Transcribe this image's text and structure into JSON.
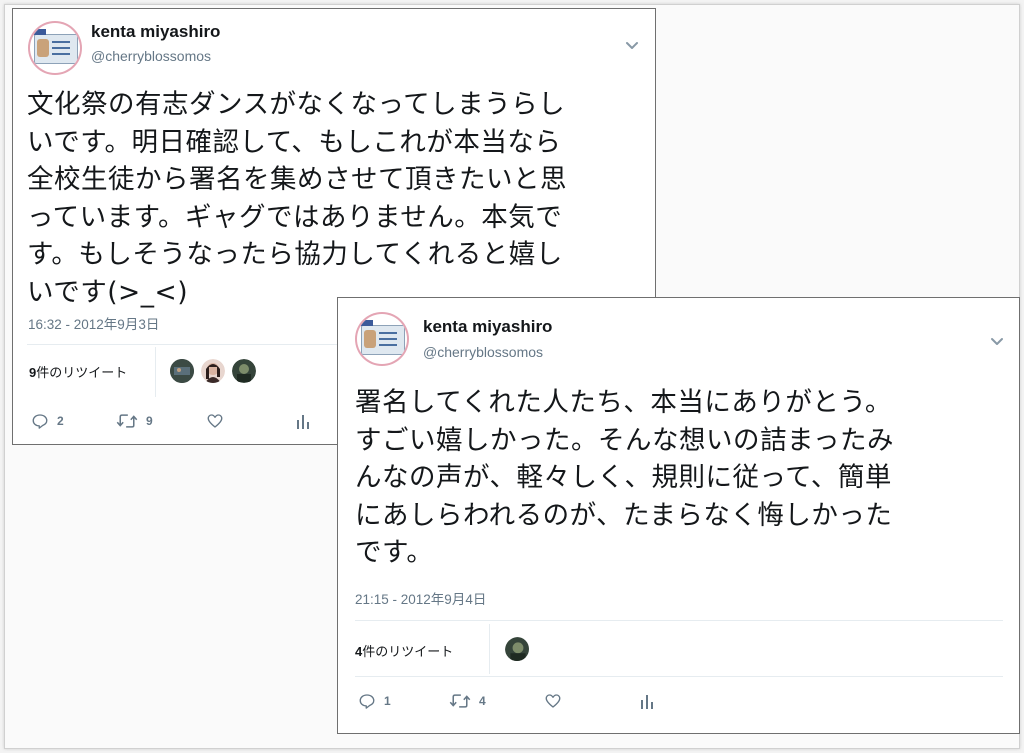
{
  "tweets": [
    {
      "author_name": "kenta miyashiro",
      "handle": "@cherryblossomos",
      "lines": [
        "文化祭の有志ダンスがなくなってしまうらし",
        "いです。明日確認して、もしこれが本当なら",
        "全校生徒から署名を集めさせて頂きたいと思",
        "っています。ギャグではありません。本気で",
        "す。もしそうなったら協力してくれると嬉し",
        "いです(>_<)"
      ],
      "timestamp": "16:32 - 2012年9月3日",
      "retweets_count": "9",
      "retweets_label": "件のリツイート",
      "replies": "2",
      "retweets": "9"
    },
    {
      "author_name": "kenta miyashiro",
      "handle": "@cherryblossomos",
      "lines": [
        "署名してくれた人たち、本当にありがとう。",
        "すごい嬉しかった。そんな想いの詰まったみ",
        "んなの声が、軽々しく、規則に従って、簡単",
        "にあしらわれるのが、たまらなく悔しかった",
        "です。"
      ],
      "timestamp": "21:15 - 2012年9月4日",
      "retweets_count": "4",
      "retweets_label": "件のリツイート",
      "replies": "1",
      "retweets": "4"
    }
  ],
  "icons": {
    "reply": "reply-icon",
    "retweet": "retweet-icon",
    "like": "heart-icon",
    "analytics": "analytics-icon",
    "more": "chevron-down-icon"
  },
  "colors": {
    "text": "#14171a",
    "secondary": "#657786",
    "avatar_ring": "#e4a5b4",
    "divider": "#e6ecf0"
  }
}
